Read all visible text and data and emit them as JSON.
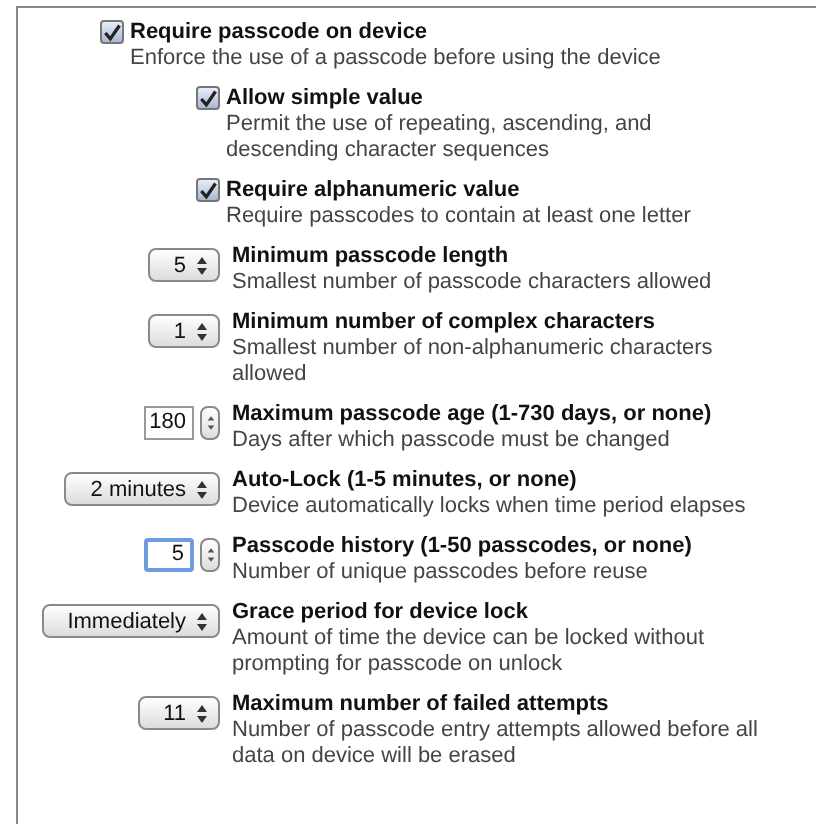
{
  "settings": [
    {
      "kind": "checkbox",
      "label": "Require passcode on device",
      "description": "Enforce the use of a passcode before using the device",
      "checked": true,
      "children": [
        {
          "label": "Allow simple value",
          "description": "Permit the use of repeating, ascending, and descending character sequences",
          "checked": true
        },
        {
          "label": "Require alphanumeric value",
          "description": "Require passcodes to contain at least one letter",
          "checked": true
        }
      ]
    },
    {
      "kind": "popup",
      "value": "5",
      "label": "Minimum passcode length",
      "description": "Smallest number of passcode characters allowed"
    },
    {
      "kind": "popup",
      "value": "1",
      "label": "Minimum number of complex characters",
      "description": "Smallest number of non-alphanumeric characters allowed"
    },
    {
      "kind": "stepper",
      "value": "180",
      "focused": false,
      "label": "Maximum passcode age (1-730 days, or none)",
      "description": "Days after which passcode must be changed"
    },
    {
      "kind": "popup",
      "value": "2 minutes",
      "label": "Auto-Lock (1-5 minutes, or none)",
      "description": "Device automatically locks when time period elapses"
    },
    {
      "kind": "stepper",
      "value": "5",
      "focused": true,
      "label": "Passcode history (1-50 passcodes, or none)",
      "description": "Number of unique passcodes before reuse"
    },
    {
      "kind": "popup",
      "value": "Immediately",
      "label": "Grace period for device lock",
      "description": "Amount of time the device can be locked without prompting for passcode on unlock"
    },
    {
      "kind": "popup",
      "value": "11",
      "label": "Maximum number of failed attempts",
      "description": "Number of passcode entry attempts allowed before all data on device will be erased"
    }
  ]
}
